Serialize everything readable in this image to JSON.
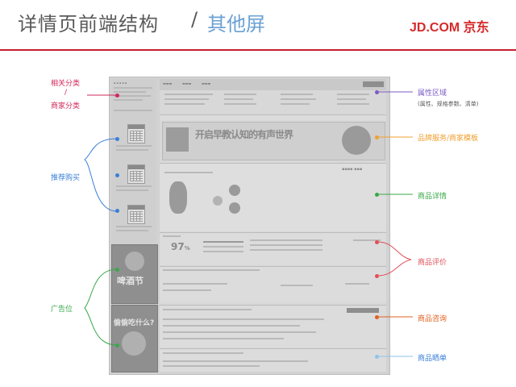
{
  "slide": {
    "title_main": "详情页前端结构",
    "title_sep": "/",
    "title_sub": "其他屏",
    "logo": "JD.COM 京东"
  },
  "labels_left": {
    "related": "相关分类",
    "slash": "/",
    "merchant": "商家分类",
    "recommend": "推荐购买",
    "ads": "广告位"
  },
  "labels_right": {
    "attributes": "属性区域",
    "attributes_sub": "(属性、规格参数、清单)",
    "brand": "品牌服务/商家模板",
    "detail": "商品详情",
    "review": "商品评价",
    "consult": "商品咨询",
    "share": "商品晒单"
  },
  "mockup": {
    "banner_text": "开启早教认知的有声世界",
    "review_percent": "97",
    "review_percent_sign": "%",
    "ad1_text": "啤酒节",
    "ad2_text": "偷偷吃什么?"
  },
  "colors": {
    "purple": "#7b5cc4",
    "orange": "#f0a030",
    "green": "#3aa84a",
    "red": "#e0505a",
    "blue": "#3a7fd8",
    "pink": "#d0285a",
    "lightblue": "#8ec4ea",
    "darkorange": "#e06020"
  }
}
